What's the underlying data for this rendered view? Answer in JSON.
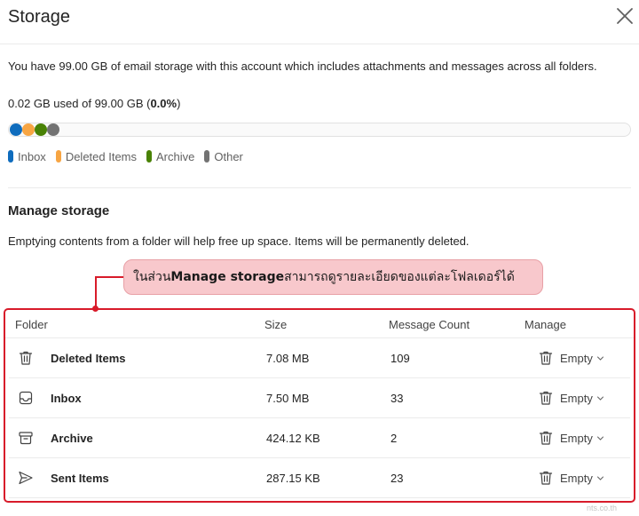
{
  "dialog": {
    "title": "Storage",
    "close_icon": "close-icon"
  },
  "summary": {
    "description": "You have 99.00 GB of email storage with this account which includes attachments and messages across all folders.",
    "used_prefix": "0.02 GB used of 99.00 GB (",
    "used_percent": "0.0%",
    "used_suffix": ")"
  },
  "usage_bar": {
    "segments": [
      {
        "name": "Inbox",
        "color": "#0f6cbd"
      },
      {
        "name": "Deleted Items",
        "color": "#f7a543"
      },
      {
        "name": "Archive",
        "color": "#498205"
      },
      {
        "name": "Other",
        "color": "#737373"
      }
    ]
  },
  "legend": {
    "items": [
      "Inbox",
      "Deleted Items",
      "Archive",
      "Other"
    ]
  },
  "manage": {
    "title": "Manage storage",
    "description": "Emptying contents from a folder will help free up space. Items will be permanently deleted."
  },
  "callout": {
    "prefix": "ในส่วน ",
    "bold": "Manage storage",
    "suffix": " สามารถดูรายละเอียดของแต่ละโฟลเดอร์ได้"
  },
  "table": {
    "headers": {
      "folder": "Folder",
      "size": "Size",
      "count": "Message Count",
      "manage": "Manage"
    },
    "rows": [
      {
        "icon": "trash-icon",
        "folder": "Deleted Items",
        "size": "7.08 MB",
        "count": "109",
        "action": "Empty"
      },
      {
        "icon": "inbox-icon",
        "folder": "Inbox",
        "size": "7.50 MB",
        "count": "33",
        "action": "Empty"
      },
      {
        "icon": "archive-icon",
        "folder": "Archive",
        "size": "424.12 KB",
        "count": "2",
        "action": "Empty"
      },
      {
        "icon": "send-icon",
        "folder": "Sent Items",
        "size": "287.15 KB",
        "count": "23",
        "action": "Empty"
      }
    ]
  },
  "watermark": "nts.co.th"
}
